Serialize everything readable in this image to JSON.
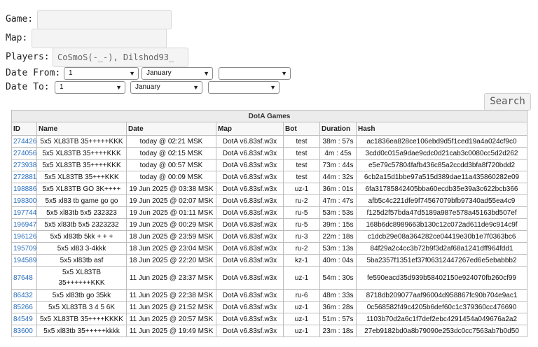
{
  "form": {
    "game_label": "Game:",
    "game_value": "",
    "map_label": "Map:",
    "map_value": "",
    "players_label": "Players:",
    "players_value": "CoSmoS(-_-), Dilshod93_",
    "date_from_label": "Date From:",
    "date_to_label": "Date To:",
    "date_from": {
      "day": "1",
      "month": "January",
      "year": ""
    },
    "date_to": {
      "day": "1",
      "month": "January",
      "year": ""
    },
    "search_label": "Search"
  },
  "table": {
    "caption": "DotA Games",
    "headers": [
      "ID",
      "Name",
      "Date",
      "Map",
      "Bot",
      "Duration",
      "Hash"
    ],
    "rows": [
      {
        "id": "274426",
        "name": "5x5 XL83TB 35+++++KKK",
        "date": "today @ 02:21 MSK",
        "map": "DotA v6.83sf.w3x",
        "bot": "test",
        "duration": "38m : 57s",
        "hash": "ac1836ea828ce106ebd9d5f1ced19a4a024cf9c0"
      },
      {
        "id": "274056",
        "name": "5x5 XL83TB 35++++KKK",
        "date": "today @ 02:15 MSK",
        "map": "DotA v6.83sf.w3x",
        "bot": "test",
        "duration": "4m : 45s",
        "hash": "3cdd0c015a9dae9cdc0d21cab3c0080cc5d2d262"
      },
      {
        "id": "273938",
        "name": "5x5 XL83TB 35++++KKK",
        "date": "today @ 00:57 MSK",
        "map": "DotA v6.83sf.w3x",
        "bot": "test",
        "duration": "73m : 44s",
        "hash": "e5e79c57804fafb436c85a2ccdd3bfa8f720bdd2"
      },
      {
        "id": "272881",
        "name": "5x5 XL83TB 35+++KKK",
        "date": "today @ 00:09 MSK",
        "map": "DotA v6.83sf.w3x",
        "bot": "test",
        "duration": "44m : 32s",
        "hash": "6cb2a15d1bbe97a515d389dae11a435860282e09"
      },
      {
        "id": "198886",
        "name": "5x5 XL83TB GO 3K++++",
        "date": "19 Jun 2025 @ 03:38 MSK",
        "map": "DotA v6.83sf.w3x",
        "bot": "uz-1",
        "duration": "36m : 01s",
        "hash": "6fa31785842405bba60ecdb35e39a3c622bcb366"
      },
      {
        "id": "198300",
        "name": "5x5 xl83 tb game go go",
        "date": "19 Jun 2025 @ 02:07 MSK",
        "map": "DotA v6.83sf.w3x",
        "bot": "ru-2",
        "duration": "47m : 47s",
        "hash": "afb5c4c221dfe9f74567079bfb97340ad55ea4c9"
      },
      {
        "id": "197744",
        "name": "5x5 xl83tb 5x5 232323",
        "date": "19 Jun 2025 @ 01:11 MSK",
        "map": "DotA v6.83sf.w3x",
        "bot": "ru-5",
        "duration": "53m : 53s",
        "hash": "f125d2f57bda47d5189a987e578a45163bd507ef"
      },
      {
        "id": "196947",
        "name": "5x5 xl83tb 5x5 2323232",
        "date": "19 Jun 2025 @ 00:29 MSK",
        "map": "DotA v6.83sf.w3x",
        "bot": "ru-5",
        "duration": "39m : 15s",
        "hash": "168b6dc8989663b130c12c072ad611de9c914c9f"
      },
      {
        "id": "196126",
        "name": "5x5 xl83tb 5kk + + +",
        "date": "18 Jun 2025 @ 23:59 MSK",
        "map": "DotA v6.83sf.w3x",
        "bot": "ru-3",
        "duration": "22m : 18s",
        "hash": "c1dcb29e08a364282ce04419e30b1e7f0363bc6"
      },
      {
        "id": "195709",
        "name": "5x5 xl83 3-4kkk",
        "date": "18 Jun 2025 @ 23:04 MSK",
        "map": "DotA v6.83sf.w3x",
        "bot": "ru-2",
        "duration": "53m : 13s",
        "hash": "84f29a2c4cc3b72b9f3d2af68a1241dff964fdd1"
      },
      {
        "id": "194589",
        "name": "5x5 xl83tb asf",
        "date": "18 Jun 2025 @ 22:20 MSK",
        "map": "DotA v6.83sf.w3x",
        "bot": "kz-1",
        "duration": "40m : 04s",
        "hash": "5ba2357f1351ef37f06312447267ed6e5ebabbb2"
      },
      {
        "id": "87648",
        "name": "5x5 XL83TB 35++++++KKK",
        "date": "11 Jun 2025 @ 23:37 MSK",
        "map": "DotA v6.83sf.w3x",
        "bot": "uz-1",
        "duration": "54m : 30s",
        "hash": "fe590eacd35d939b58402150e924070fb260cf99",
        "tall": true
      },
      {
        "id": "86432",
        "name": "5x5 xl83tb go 35kk",
        "date": "11 Jun 2025 @ 22:38 MSK",
        "map": "DotA v6.83sf.w3x",
        "bot": "ru-6",
        "duration": "48m : 33s",
        "hash": "8718db209077aaf96004d958867fc90b704e9ac1"
      },
      {
        "id": "85266",
        "name": "5x5 XL83TB 3 4 5 6K",
        "date": "11 Jun 2025 @ 21:52 MSK",
        "map": "DotA v6.83sf.w3x",
        "bot": "uz-1",
        "duration": "36m : 28s",
        "hash": "0c568582f49c4205b6def60c1c379360cc476690"
      },
      {
        "id": "84549",
        "name": "5x5 XL83TB 35++++KKKK",
        "date": "11 Jun 2025 @ 20:57 MSK",
        "map": "DotA v6.83sf.w3x",
        "bot": "uz-1",
        "duration": "51m : 57s",
        "hash": "1103b70d2a6c1f7def2ebc4291454a049676a2a2"
      },
      {
        "id": "83600",
        "name": "5x5 xl83tb 35+++++kkkk",
        "date": "11 Jun 2025 @ 19:49 MSK",
        "map": "DotA v6.83sf.w3x",
        "bot": "uz-1",
        "duration": "23m : 18s",
        "hash": "27eb9182bd0a8b79090e253dc0cc7563ab7b0d50"
      }
    ]
  }
}
